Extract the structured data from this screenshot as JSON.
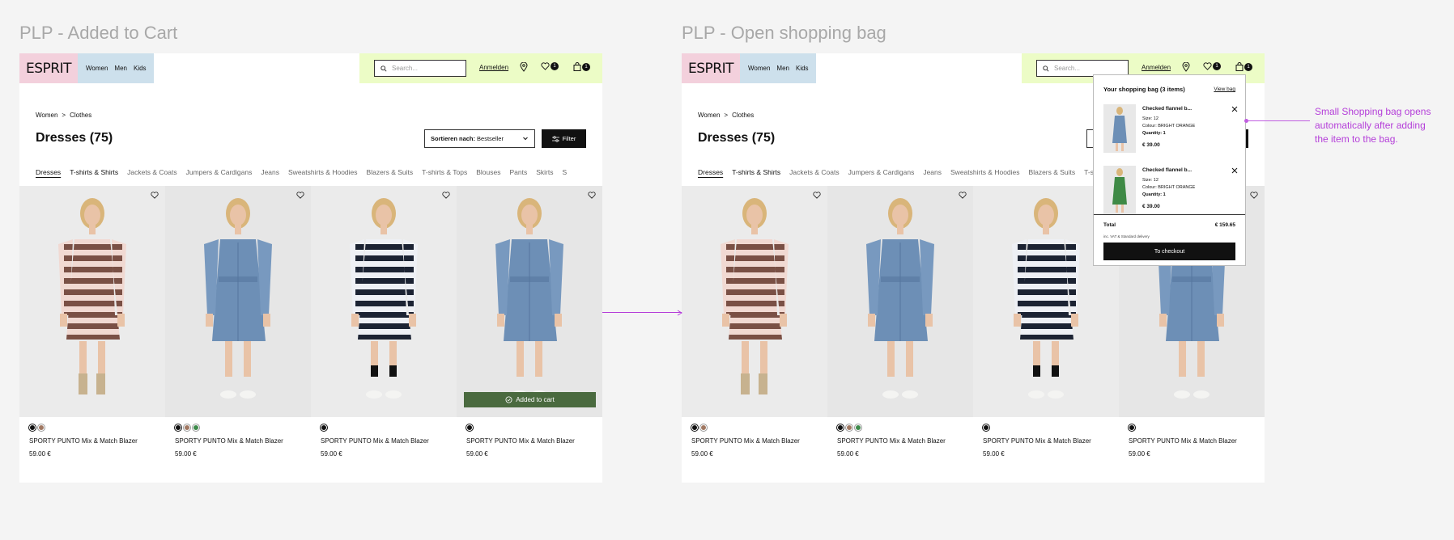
{
  "frames": [
    {
      "title": "PLP - Added to Cart"
    },
    {
      "title": "PLP - Open shopping bag"
    }
  ],
  "header": {
    "logo": "ESPRIT",
    "nav": [
      "Women",
      "Men",
      "Kids"
    ],
    "search_placeholder": "Search...",
    "login": "Anmelden",
    "wishlist_count": "1",
    "bag_count": "1"
  },
  "breadcrumb": {
    "home": "Women",
    "sep": ">",
    "current": "Clothes"
  },
  "page_title": "Dresses (75)",
  "sort": {
    "label": "Sortieren nach:",
    "value": "Bestseller"
  },
  "filter_label": "Filter",
  "categories": [
    "Dresses",
    "T-shirts & Shirts",
    "Jackets & Coats",
    "Jumpers & Cardigans",
    "Jeans",
    "Sweatshirts & Hoodies",
    "Blazers & Suits",
    "T-shirts & Tops",
    "Blouses",
    "Pants",
    "Skirts",
    "S"
  ],
  "products": [
    {
      "name": "SPORTY PUNTO Mix & Match Blazer",
      "price": "59.00 €",
      "swatches": [
        "#111111",
        "#a07862"
      ],
      "dress": "stripe-brown"
    },
    {
      "name": "SPORTY PUNTO Mix & Match Blazer",
      "price": "59.00 €",
      "swatches": [
        "#111111",
        "#a07862",
        "#3d8a4a"
      ],
      "dress": "denim"
    },
    {
      "name": "SPORTY PUNTO Mix & Match Blazer",
      "price": "59.00 €",
      "swatches": [
        "#111111"
      ],
      "dress": "stripe-navy"
    },
    {
      "name": "SPORTY PUNTO Mix & Match Blazer",
      "price": "59.00 €",
      "swatches": [
        "#111111"
      ],
      "dress": "denim"
    }
  ],
  "added_to_cart": "Added to cart",
  "minibag": {
    "title": "Your shopping bag (3 items)",
    "view": "View bag",
    "items": [
      {
        "name": "Checked flannel b...",
        "size": "Size: 12",
        "colour": "Colour: BRIGHT ORANGE",
        "qty": "Quantity: 1",
        "price": "€ 39.00",
        "thumb": "denim"
      },
      {
        "name": "Checked flannel b...",
        "size": "Size: 12",
        "colour": "Colour: BRIGHT ORANGE",
        "qty": "Quantity: 1",
        "price": "€ 39.00",
        "thumb": "green"
      }
    ],
    "total_label": "Total",
    "total_value": "€ 159.65",
    "vat": "inc. VAT & Standard delivery",
    "checkout": "To checkout"
  },
  "annotation": "Small Shopping bag opens automatically after adding the item to the bag.",
  "colors": {
    "pink": "#f3d0dc",
    "blue": "#cde0ec",
    "lime": "#ecfcc6",
    "green_button": "#4a6a3f",
    "annotation": "#b43ed9"
  }
}
